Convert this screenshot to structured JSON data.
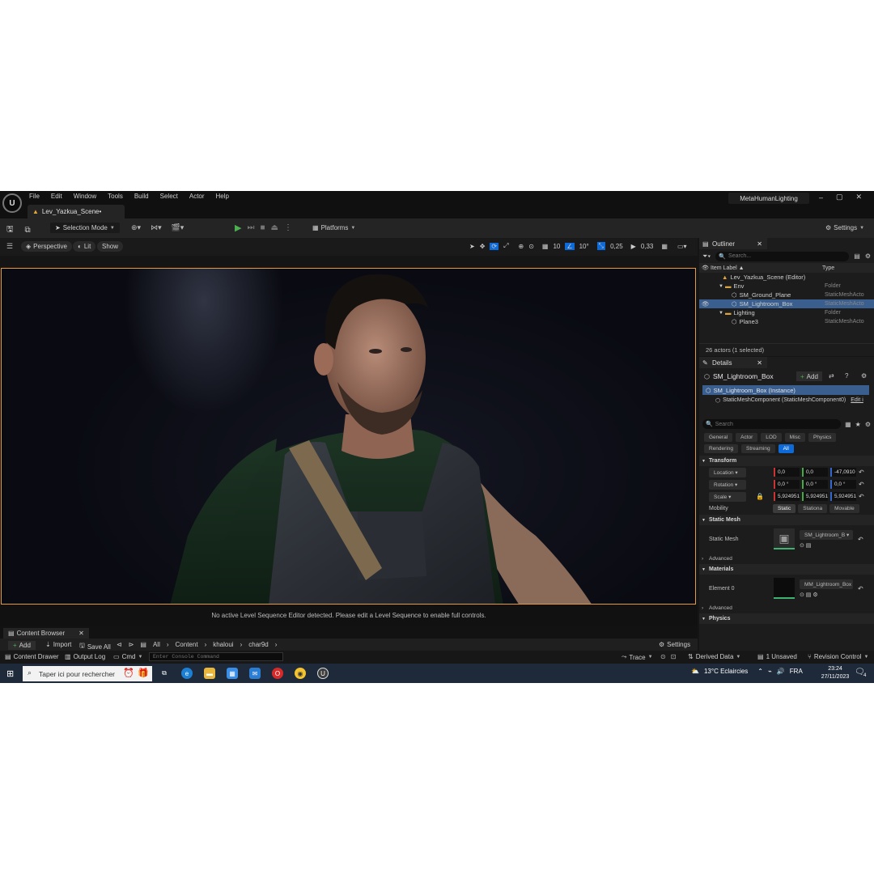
{
  "titlebar": {
    "menu": [
      "File",
      "Edit",
      "Window",
      "Tools",
      "Build",
      "Select",
      "Actor",
      "Help"
    ],
    "level_tab": "Lev_Yazkua_Scene•",
    "project_name": "MetaHumanLighting",
    "window_controls": [
      "–",
      "▢",
      "✕"
    ]
  },
  "toolbar": {
    "selection_mode": "Selection Mode",
    "platforms": "Platforms",
    "settings": "Settings"
  },
  "viewport_bar": {
    "perspective": "Perspective",
    "lit": "Lit",
    "show": "Show",
    "grid_snap": "10",
    "rotation_snap": "10°",
    "scale_snap": "0,25",
    "camera_speed": "0,33"
  },
  "sequencer_message": "No active Level Sequence Editor detected. Please edit a Level Sequence to enable full controls.",
  "content_browser": {
    "tab": "Content Browser",
    "add": "Add",
    "import": "Import",
    "save_all": "Save All",
    "path": [
      "All",
      "Content",
      "khaloui",
      "char9d"
    ],
    "settings": "Settings"
  },
  "statusbar": {
    "content_drawer": "Content Drawer",
    "output_log": "Output Log",
    "cmd": "Cmd",
    "console_placeholder": "Enter Console Command",
    "trace": "Trace",
    "derived_data": "Derived Data",
    "unsaved": "1 Unsaved",
    "revision_control": "Revision Control"
  },
  "outliner": {
    "title": "Outliner",
    "search_placeholder": "Search...",
    "col_label": "Item Label ▲",
    "col_type": "Type",
    "rows": [
      {
        "label": "Lev_Yazkua_Scene (Editor)",
        "type": ""
      },
      {
        "label": "Env",
        "type": "Folder"
      },
      {
        "label": "SM_Ground_Plane",
        "type": "StaticMeshActo"
      },
      {
        "label": "SM_Lightroom_Box",
        "type": "StaticMeshActo"
      },
      {
        "label": "Lighting",
        "type": "Folder"
      },
      {
        "label": "Plane3",
        "type": "StaticMeshActo"
      }
    ],
    "footer": "26 actors (1 selected)"
  },
  "details": {
    "title": "Details",
    "actor_name": "SM_Lightroom_Box",
    "add": "Add",
    "instance": "SM_Lightroom_Box (Instance)",
    "component": "StaticMeshComponent (StaticMeshComponent0)",
    "edit_link": "Edit i",
    "search_placeholder": "Search",
    "filters_row1": [
      "General",
      "Actor",
      "LOD",
      "Misc",
      "Physics"
    ],
    "filters_row2": [
      "Rendering",
      "Streaming",
      "All"
    ],
    "transform_header": "Transform",
    "location_label": "Location",
    "location": [
      "0,0",
      "0,0",
      "-47,0910"
    ],
    "rotation_label": "Rotation",
    "rotation": [
      "0,0 °",
      "0,0 °",
      "0,0 °"
    ],
    "scale_label": "Scale",
    "scale": [
      "5,924951",
      "5,924951",
      "5,924951"
    ],
    "mobility_label": "Mobility",
    "mobility_options": [
      "Static",
      "Stationa",
      "Movable"
    ],
    "static_mesh_header": "Static Mesh",
    "static_mesh_label": "Static Mesh",
    "static_mesh_value": "SM_Lightroom_B",
    "advanced": "Advanced",
    "materials_header": "Materials",
    "element0_label": "Element 0",
    "element0_value": "MM_Lightroom_Box",
    "advanced2": "Advanced",
    "physics_header": "Physics"
  },
  "taskbar": {
    "search_placeholder": "Taper ici pour rechercher",
    "weather": "13°C  Eclaircies",
    "language": "FRA",
    "time": "23:24",
    "date": "27/11/2023",
    "notification_count": "4"
  },
  "colors": {
    "accent_blue": "#0e6ad6",
    "play_green": "#4caf50",
    "viewport_border": "#e59a3c",
    "selection": "#3a5f8f"
  }
}
